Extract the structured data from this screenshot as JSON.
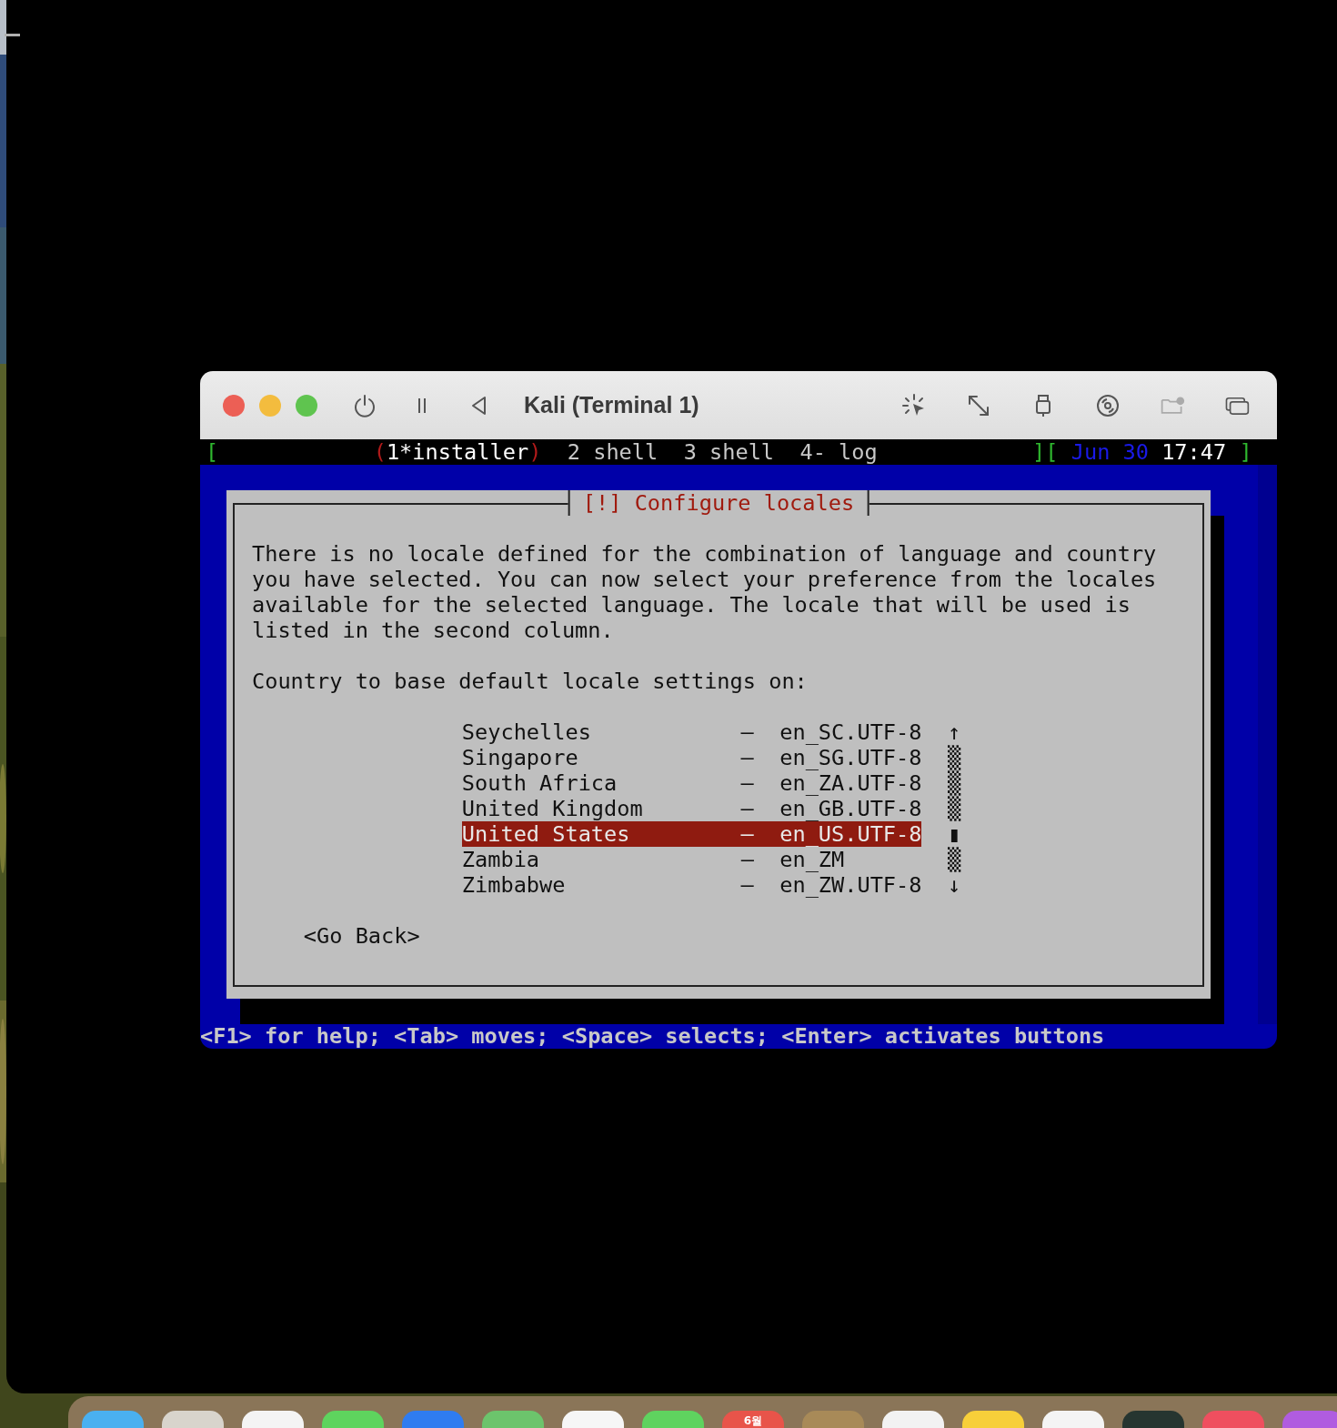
{
  "window": {
    "title": "Kali (Terminal 1)"
  },
  "tmux_bar": {
    "open_bracket": "[",
    "windows": [
      {
        "label": "1*installer",
        "open_mark": "(",
        "close_mark": ")",
        "selected": true
      },
      {
        "label": "2 shell",
        "selected": false
      },
      {
        "label": "3 shell",
        "selected": false
      },
      {
        "label": "4- log",
        "selected": false
      }
    ],
    "mid_bracket": "][",
    "date": "Jun 30",
    "time": "17:47",
    "close_bracket": "]"
  },
  "dialog": {
    "title": "[!] Configure locales",
    "description": "There is no locale defined for the combination of language and country you have selected. You can now select your preference from the locales available for the selected language. The locale that will be used is listed in the second column.",
    "prompt": "Country to base default locale settings on:",
    "items": [
      {
        "country": "Seychelles",
        "dash": "–",
        "locale": "en_SC.UTF-8",
        "scroll": "↑",
        "selected": false
      },
      {
        "country": "Singapore",
        "dash": "–",
        "locale": "en_SG.UTF-8",
        "scroll": "▒",
        "selected": false
      },
      {
        "country": "South Africa",
        "dash": "–",
        "locale": "en_ZA.UTF-8",
        "scroll": "▒",
        "selected": false
      },
      {
        "country": "United Kingdom",
        "dash": "–",
        "locale": "en_GB.UTF-8",
        "scroll": "▒",
        "selected": false
      },
      {
        "country": "United States",
        "dash": "–",
        "locale": "en_US.UTF-8",
        "scroll": "▮",
        "selected": true
      },
      {
        "country": "Zambia",
        "dash": "–",
        "locale": "en_ZM",
        "scroll": "▒",
        "selected": false
      },
      {
        "country": "Zimbabwe",
        "dash": "–",
        "locale": "en_ZW.UTF-8",
        "scroll": "↓",
        "selected": false
      }
    ],
    "button": "<Go Back>"
  },
  "help_line": "<F1> for help; <Tab> moves; <Space> selects; <Enter> activates buttons",
  "dock": {
    "items": [
      {
        "color": "#4ab0f0"
      },
      {
        "color": "#d8d4cc"
      },
      {
        "color": "#f4f4f4"
      },
      {
        "color": "#5ed45e"
      },
      {
        "color": "#2f7cf0"
      },
      {
        "color": "#6cc46c"
      },
      {
        "color": "#f6f6f6"
      },
      {
        "color": "#5fd35f"
      },
      {
        "color": "#e8544a",
        "label": "6월"
      },
      {
        "color": "#a88a58"
      },
      {
        "color": "#f2f2f2"
      },
      {
        "color": "#f7cf3a"
      },
      {
        "color": "#f4f4f4"
      },
      {
        "color": "#263530"
      },
      {
        "color": "#ef4f5f"
      },
      {
        "color": "#b05ce0"
      }
    ]
  }
}
